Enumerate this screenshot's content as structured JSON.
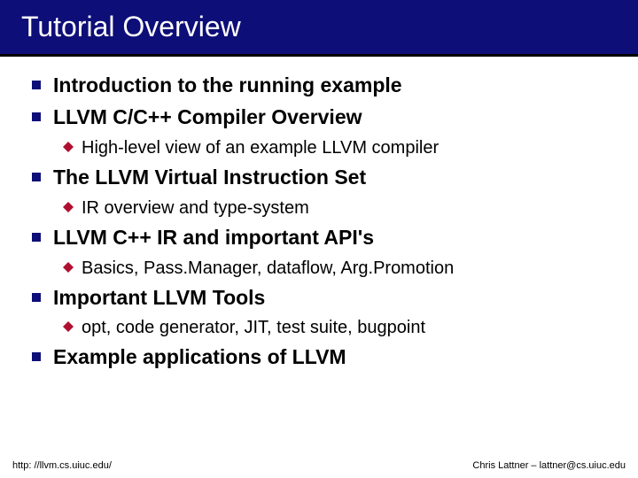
{
  "title": "Tutorial Overview",
  "items": [
    {
      "text": "Introduction to the running example"
    },
    {
      "text": "LLVM C/C++ Compiler Overview",
      "sub": [
        "High-level view of an example LLVM compiler"
      ]
    },
    {
      "text": "The LLVM Virtual Instruction Set",
      "sub": [
        "IR overview and type-system"
      ]
    },
    {
      "text": "LLVM C++ IR and important API's",
      "sub": [
        "Basics, Pass.Manager, dataflow, Arg.Promotion"
      ]
    },
    {
      "text": "Important LLVM Tools",
      "sub": [
        "opt, code generator, JIT, test suite, bugpoint"
      ]
    },
    {
      "text": "Example applications of LLVM"
    }
  ],
  "footer": {
    "left": "http: //llvm.cs.uiuc.edu/",
    "right": "Chris Lattner – lattner@cs.uiuc.edu"
  },
  "colors": {
    "accent": "#0e0e78",
    "diamond": "#b01030"
  }
}
